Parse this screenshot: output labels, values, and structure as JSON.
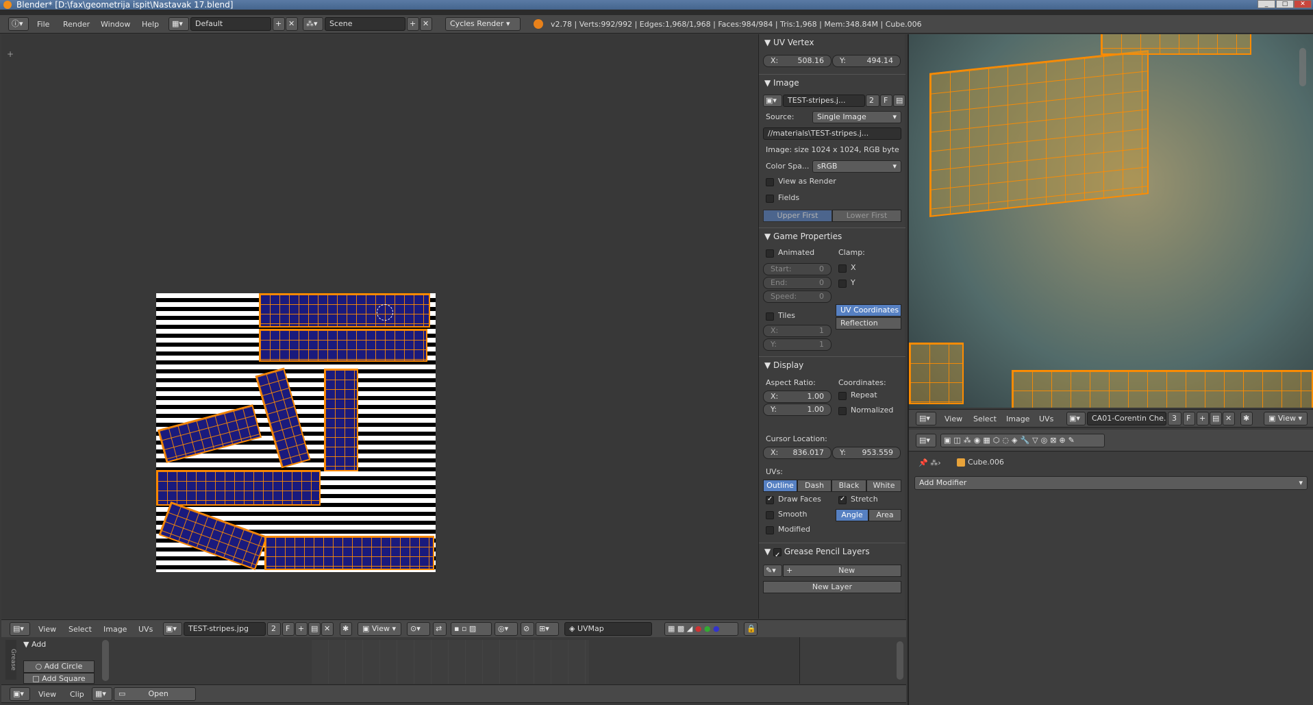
{
  "window": {
    "title": "Blender* [D:\\fax\\geometrija ispit\\Nastavak 17.blend]"
  },
  "info": {
    "menus": [
      "File",
      "Render",
      "Window",
      "Help"
    ],
    "layout": "Default",
    "scene": "Scene",
    "engine": "Cycles Render",
    "stats": "v2.78 | Verts:992/992 | Edges:1,968/1,968 | Faces:984/984 | Tris:1,968 | Mem:348.84M | Cube.006"
  },
  "uv_vertex": {
    "title": "UV Vertex",
    "x_label": "X:",
    "x": "508.16",
    "y_label": "Y:",
    "y": "494.14"
  },
  "image": {
    "title": "Image",
    "name": "TEST-stripes.j...",
    "users": "2",
    "fake": "F",
    "source_label": "Source:",
    "source": "Single Image",
    "path": "//materials\\TEST-stripes.j...",
    "info": "Image: size 1024 x 1024, RGB byte",
    "colorspace_label": "Color Spa...",
    "colorspace": "sRGB",
    "view_as_render": "View as Render",
    "fields": "Fields",
    "upper_first": "Upper First",
    "lower_first": "Lower First"
  },
  "game": {
    "title": "Game Properties",
    "animated": "Animated",
    "clamp": "Clamp:",
    "x": "X",
    "y": "Y",
    "start": "Start:",
    "start_v": "0",
    "end": "End:",
    "end_v": "0",
    "speed": "Speed:",
    "speed_v": "0",
    "tiles": "Tiles",
    "tx": "X:",
    "tx_v": "1",
    "ty": "Y:",
    "ty_v": "1",
    "uv_coords": "UV Coordinates",
    "reflection": "Reflection"
  },
  "display": {
    "title": "Display",
    "aspect": "Aspect Ratio:",
    "coords": "Coordinates:",
    "ax": "X:",
    "ax_v": "1.00",
    "ay": "Y:",
    "ay_v": "1.00",
    "repeat": "Repeat",
    "normalized": "Normalized",
    "cursor": "Cursor Location:",
    "cx": "X:",
    "cx_v": "836.017",
    "cy": "Y:",
    "cy_v": "953.559",
    "uvs": "UVs:",
    "outline": "Outline",
    "dash": "Dash",
    "black": "Black",
    "white": "White",
    "draw_faces": "Draw Faces",
    "stretch": "Stretch",
    "smooth": "Smooth",
    "angle": "Angle",
    "area": "Area",
    "modified": "Modified"
  },
  "grease": {
    "title": "Grease Pencil Layers",
    "new": "New",
    "new_layer": "New Layer"
  },
  "uv_header": {
    "menus": [
      "View",
      "Select",
      "Image",
      "UVs"
    ],
    "image": "TEST-stripes.jpg",
    "users": "2",
    "fake": "F",
    "view": "View",
    "uvmap": "UVMap"
  },
  "tool": {
    "tab": "Grease",
    "add": "Add",
    "add_circle": "Add Circle",
    "add_square": "Add Square"
  },
  "clip_header": {
    "menus": [
      "View",
      "Clip"
    ],
    "open": "Open"
  },
  "view3d_header": {
    "menus": [
      "View",
      "Select",
      "Image",
      "UVs"
    ],
    "image": "CA01-Corentin Che...",
    "users": "3",
    "fake": "F",
    "view": "View"
  },
  "properties": {
    "object": "Cube.006",
    "add_modifier": "Add Modifier"
  }
}
